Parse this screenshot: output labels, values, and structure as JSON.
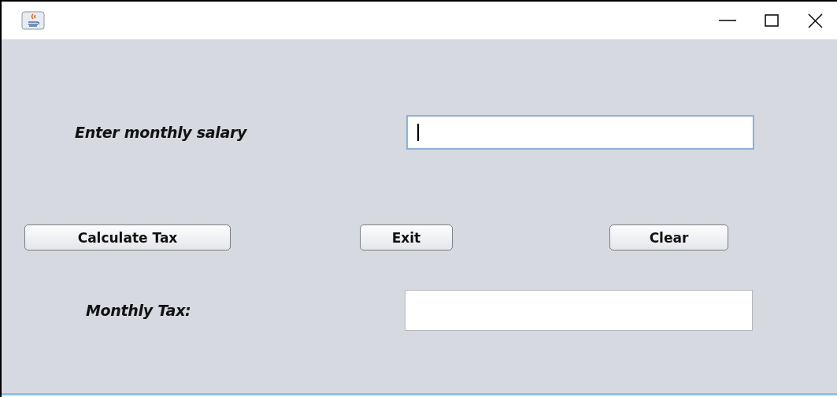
{
  "salary": {
    "label": "Enter monthly salary",
    "focused": true
  },
  "buttons": [
    {
      "label": "Calculate Tax"
    },
    {
      "label": "Exit"
    },
    {
      "label": "Clear"
    }
  ],
  "tax": {
    "label": "Monthly Tax:",
    "focused": false
  }
}
